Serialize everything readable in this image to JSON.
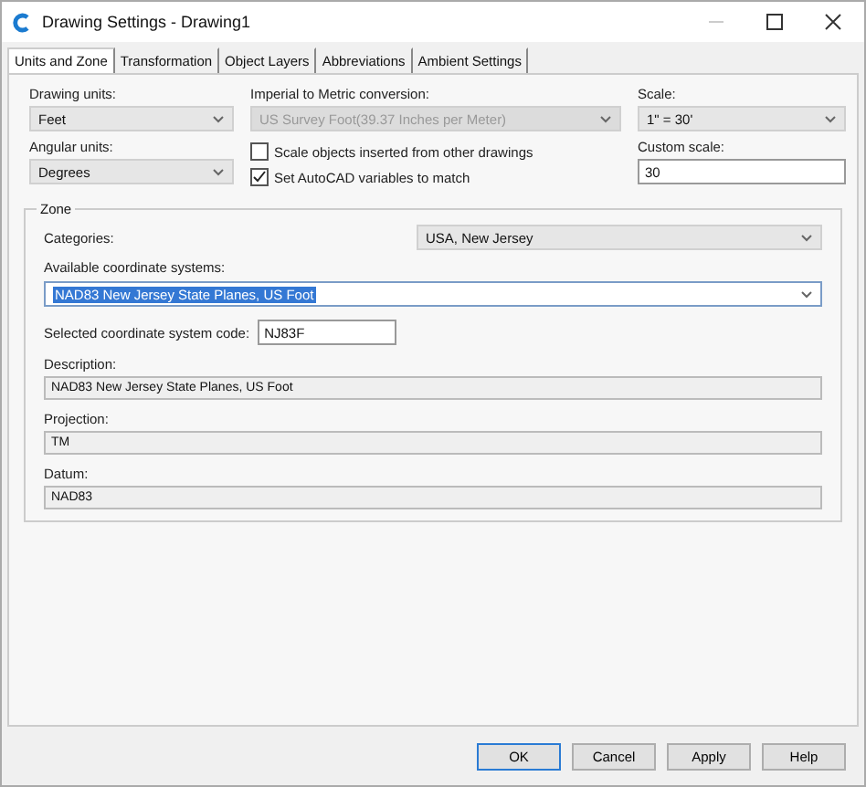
{
  "window": {
    "title": "Drawing Settings - Drawing1"
  },
  "tabs": [
    {
      "label": "Units and Zone",
      "selected": true
    },
    {
      "label": "Transformation",
      "selected": false
    },
    {
      "label": "Object Layers",
      "selected": false
    },
    {
      "label": "Abbreviations",
      "selected": false
    },
    {
      "label": "Ambient Settings",
      "selected": false
    }
  ],
  "drawing_units": {
    "label": "Drawing units:",
    "value": "Feet"
  },
  "angular_units": {
    "label": "Angular units:",
    "value": "Degrees"
  },
  "conversion": {
    "label": "Imperial to Metric conversion:",
    "value": "US Survey Foot(39.37 Inches per Meter)",
    "disabled": true
  },
  "options": [
    {
      "label": "Scale objects inserted from other drawings",
      "checked": false
    },
    {
      "label": "Set AutoCAD variables to match",
      "checked": true
    }
  ],
  "scale": {
    "label": "Scale:",
    "value": "1\" = 30'"
  },
  "custom_scale": {
    "label": "Custom scale:",
    "value": "30"
  },
  "zone": {
    "title": "Zone",
    "categories": {
      "label": "Categories:",
      "value": "USA, New Jersey"
    },
    "available": {
      "label": "Available coordinate systems:",
      "value": "NAD83 New Jersey State Planes, US Foot",
      "highlighted": true
    },
    "code": {
      "label": "Selected coordinate system code:",
      "value": "NJ83F"
    },
    "details": [
      {
        "label": "Description:",
        "value": "NAD83 New Jersey State Planes, US Foot"
      },
      {
        "label": "Projection:",
        "value": "TM"
      },
      {
        "label": "Datum:",
        "value": "NAD83"
      }
    ]
  },
  "buttons": [
    {
      "label": "OK",
      "default": true
    },
    {
      "label": "Cancel",
      "default": false
    },
    {
      "label": "Apply",
      "default": false
    },
    {
      "label": "Help",
      "default": false
    }
  ]
}
